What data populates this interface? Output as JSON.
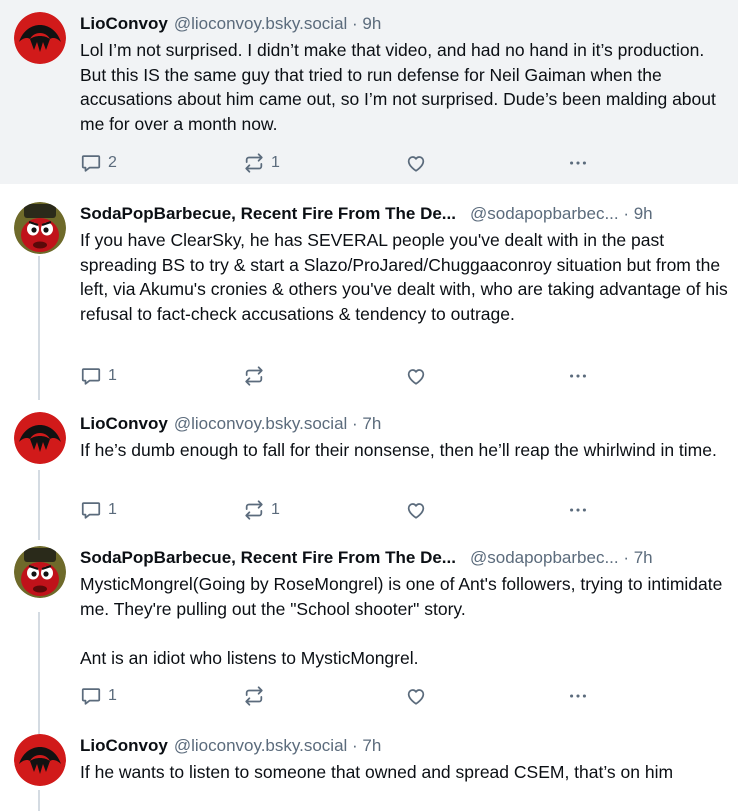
{
  "posts": [
    {
      "author": "LioConvoy",
      "handle": "@lioconvoy.bsky.social",
      "time": " · 9h",
      "text": "Lol I’m not surprised. I didn’t make that video, and had no hand in it’s production. But this IS the same guy that tried to run defense for Neil Gaiman when the accusations about him came out, so I’m not surprised. Dude’s been malding about me for over a month now.",
      "replies": "2",
      "reposts": "1",
      "likes": ""
    },
    {
      "author": "SodaPopBarbecue, Recent Fire From The De...",
      "handle": "@sodapopbarbec...",
      "time": " · 9h",
      "text": "If you have ClearSky, he has SEVERAL people you've dealt with in the past spreading BS to try & start a Slazo/ProJared/Chuggaaconroy situation but from the left, via Akumu's cronies & others you've dealt with, who are taking advantage of his refusal to fact-check accusations & tendency to outrage.",
      "replies": "1",
      "reposts": "",
      "likes": ""
    },
    {
      "author": "LioConvoy",
      "handle": "@lioconvoy.bsky.social",
      "time": " · 7h",
      "text": "If he’s dumb enough to fall for their nonsense, then he’ll reap the whirlwind in time.",
      "replies": "1",
      "reposts": "1",
      "likes": ""
    },
    {
      "author": "SodaPopBarbecue, Recent Fire From The De...",
      "handle": "@sodapopbarbec...",
      "time": " · 7h",
      "text": "MysticMongrel(Going by RoseMongrel) is one of Ant's followers, trying to intimidate me. They're pulling out the \"School shooter\" story.\n\nAnt is an idiot who listens to MysticMongrel.",
      "replies": "1",
      "reposts": "",
      "likes": ""
    },
    {
      "author": "LioConvoy",
      "handle": "@lioconvoy.bsky.social",
      "time": " · 7h",
      "text": "If he wants to listen to someone that owned and spread CSEM, that’s on him",
      "replies": "",
      "reposts": "",
      "likes": ""
    }
  ],
  "icons": {
    "reply": "reply-icon",
    "repost": "repost-icon",
    "like": "heart-icon",
    "more": "more-icon",
    "lio_avatar": "thundercats-logo-avatar",
    "soda_avatar": "character-avatar"
  },
  "colors": {
    "highlight_bg": "#f1f3f5",
    "muted": "#5b6b7c",
    "thread_line": "#d4dbe2",
    "logo_red": "#d11a1a"
  }
}
